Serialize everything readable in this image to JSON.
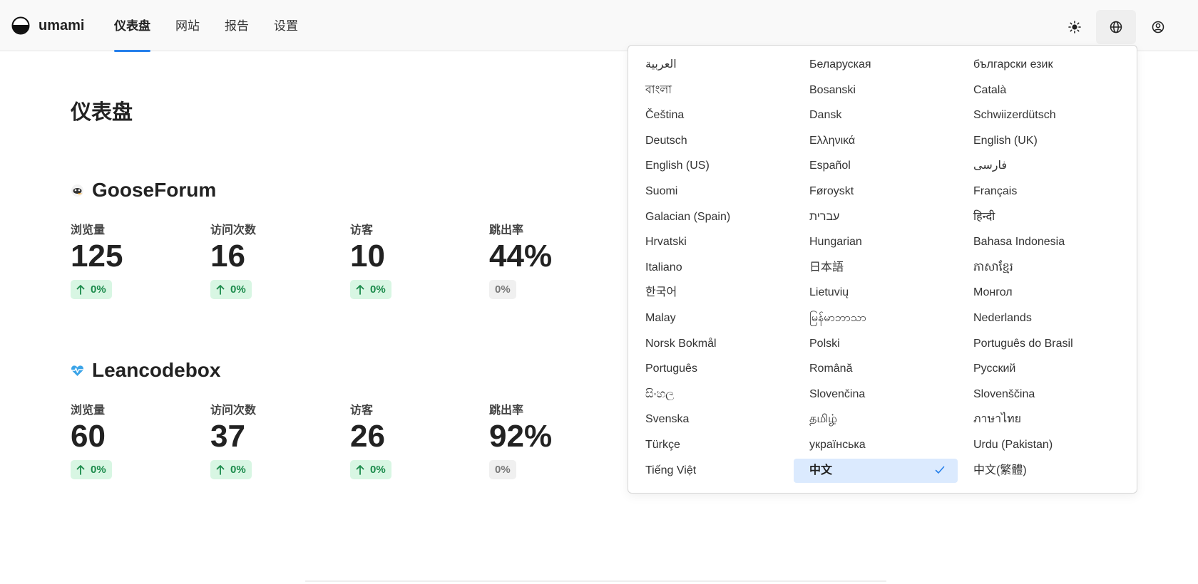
{
  "app": {
    "name": "umami"
  },
  "nav": {
    "items": [
      {
        "label": "仪表盘",
        "active": true
      },
      {
        "label": "网站",
        "active": false
      },
      {
        "label": "报告",
        "active": false
      },
      {
        "label": "设置",
        "active": false
      }
    ]
  },
  "header": {
    "icons": [
      "sun-icon",
      "globe-icon",
      "user-circle-icon"
    ]
  },
  "page": {
    "title": "仪表盘"
  },
  "sites": [
    {
      "name": "GooseForum",
      "icon": "goose-favicon-icon",
      "metrics": [
        {
          "label": "浏览量",
          "value": "125",
          "change": "0%",
          "trend": "up"
        },
        {
          "label": "访问次数",
          "value": "16",
          "change": "0%",
          "trend": "up"
        },
        {
          "label": "访客",
          "value": "10",
          "change": "0%",
          "trend": "up"
        },
        {
          "label": "跳出率",
          "value": "44%",
          "change": "0%",
          "trend": "neutral"
        }
      ]
    },
    {
      "name": "Leancodebox",
      "icon": "heartbeat-icon",
      "metrics": [
        {
          "label": "浏览量",
          "value": "60",
          "change": "0%",
          "trend": "up"
        },
        {
          "label": "访问次数",
          "value": "37",
          "change": "0%",
          "trend": "up"
        },
        {
          "label": "访客",
          "value": "26",
          "change": "0%",
          "trend": "up"
        },
        {
          "label": "跳出率",
          "value": "92%",
          "change": "0%",
          "trend": "neutral"
        }
      ]
    }
  ],
  "language_menu": {
    "selected": "中文",
    "items": [
      "العربية",
      "Беларуская",
      "български език",
      "বাংলা",
      "Bosanski",
      "Català",
      "Čeština",
      "Dansk",
      "Schwiizerdütsch",
      "Deutsch",
      "Ελληνικά",
      "English (UK)",
      "English (US)",
      "Español",
      "فارسی",
      "Suomi",
      "Føroyskt",
      "Français",
      "Galacian (Spain)",
      "עברית",
      "हिन्दी",
      "Hrvatski",
      "Hungarian",
      "Bahasa Indonesia",
      "Italiano",
      "日本語",
      "ភាសាខ្មែរ",
      "한국어",
      "Lietuvių",
      "Монгол",
      "Malay",
      "မြန်မာဘာသာ",
      "Nederlands",
      "Norsk Bokmål",
      "Polski",
      "Português do Brasil",
      "Português",
      "Română",
      "Русский",
      "සිංහල",
      "Slovenčina",
      "Slovenščina",
      "Svenska",
      "தமிழ்",
      "ภาษาไทย",
      "Türkçe",
      "українська",
      "Urdu (Pakistan)",
      "Tiếng Việt",
      "中文",
      "中文(繁體)"
    ]
  },
  "colors": {
    "accent": "#2680eb",
    "badge_up_bg": "#d8f6e3",
    "badge_up_text": "#1a8a4a",
    "selected_bg": "#dbeafe"
  }
}
